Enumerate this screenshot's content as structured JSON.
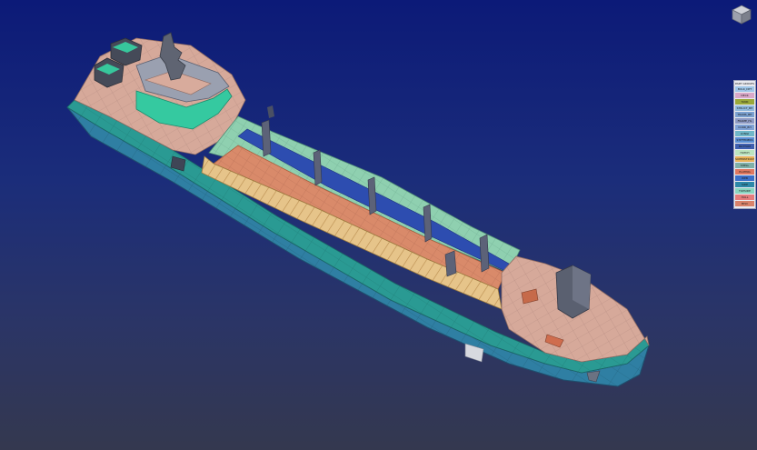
{
  "viewer": {
    "background_top": "#0c1a78",
    "background_bottom": "#34384f",
    "view_cube_icon": "view-cube-icon"
  },
  "legend": {
    "title": "PART GROUPS",
    "items": [
      {
        "label": "BULK_DPT",
        "color": "#9fc6e8"
      },
      {
        "label": "DECK",
        "color": "#d9a8c8"
      },
      {
        "label": "TANK",
        "color": "#9aa83a"
      },
      {
        "label": "STRUCT_BH",
        "color": "#8fb8dc"
      },
      {
        "label": "TRANS_BH",
        "color": "#7aa0d0"
      },
      {
        "label": "FRAME_HL",
        "color": "#8d9ac4"
      },
      {
        "label": "CORR_BH",
        "color": "#7fa2d6"
      },
      {
        "label": "LONGI",
        "color": "#6fb7c8"
      },
      {
        "label": "STIFFENERS",
        "color": "#5b8fd4"
      },
      {
        "label": "BOTTOM",
        "color": "#3f5fb0"
      },
      {
        "label": "HATCH",
        "color": "#bce5c0"
      },
      {
        "label": "SUPERSTRUCTURE",
        "color": "#e7b25a"
      },
      {
        "label": "SHELL",
        "color": "#7fb0a8"
      },
      {
        "label": "PLATING",
        "color": "#e07860"
      },
      {
        "label": "WEB",
        "color": "#3a6fc8"
      },
      {
        "label": "SIDE",
        "color": "#2d88a8"
      },
      {
        "label": "TOPSIDE",
        "color": "#8ad6c0"
      },
      {
        "label": "HULL",
        "color": "#e57c7c"
      },
      {
        "label": "MISC",
        "color": "#d8826a"
      }
    ]
  }
}
